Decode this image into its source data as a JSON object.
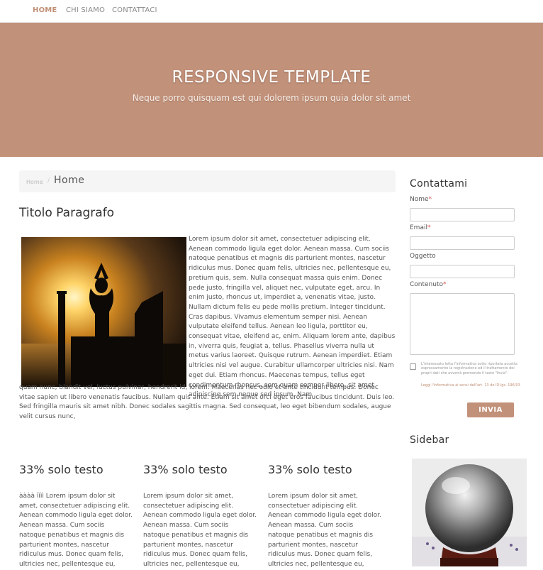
{
  "nav": {
    "items": [
      "HOME",
      "CHI SIAMO",
      "CONTATTACI"
    ]
  },
  "hero": {
    "title": "RESPONSIVE TEMPLATE",
    "subtitle": "Neque porro quisquam est qui dolorem ipsum quia dolor sit amet"
  },
  "breadcrumb": {
    "home": "Home",
    "separator": "/",
    "current": "Home"
  },
  "article": {
    "title": "Titolo Paragrafo",
    "text_right": "Lorem ipsum dolor sit amet, consectetuer adipiscing elit. Aenean commodo ligula eget dolor. Aenean massa. Cum sociis natoque penatibus et magnis dis parturient montes, nascetur ridiculus mus. Donec quam felis, ultricies nec, pellentesque eu, pretium quis, sem. Nulla consequat massa quis enim. Donec pede justo, fringilla vel, aliquet nec, vulputate eget, arcu. In enim justo, rhoncus ut, imperdiet a, venenatis vitae, justo. Nullam dictum felis eu pede mollis pretium. Integer tincidunt. Cras dapibus. Vivamus elementum semper nisi. Aenean vulputate eleifend tellus. Aenean leo ligula, porttitor eu, consequat vitae, eleifend ac, enim. Aliquam lorem ante, dapibus in, viverra quis, feugiat a, tellus. Phasellus viverra nulla ut metus varius laoreet. Quisque rutrum. Aenean imperdiet. Etiam ultricies nisi vel augue. Curabitur ullamcorper ultricies nisi. Nam eget dui. Etiam rhoncus. Maecenas tempus, tellus eget condimentum rhoncus, sem quam semper libero, sit amet adipiscing sem neque sed ipsum. Nam",
    "text_continued": "quam nunc, blandit vel, luctus pulvinar, hendrerit id, lorem. Maecenas nec odio et ante tincidunt tempus. Donec vitae sapien ut libero venenatis faucibus. Nullam quis ante. Etiam sit amet orci eget eros faucibus tincidunt. Duis leo. Sed fringilla mauris sit amet nibh. Donec sodales sagittis magna. Sed consequat, leo eget bibendum sodales, augue velit cursus nunc,"
  },
  "columns": [
    {
      "title": "33% solo testo",
      "text": "àààà ìììì Lorem ipsum dolor sit amet, consectetuer adipiscing elit. Aenean commodo ligula eget dolor. Aenean massa. Cum sociis natoque penatibus et magnis dis parturient montes, nascetur ridiculus mus. Donec quam felis, ultricies nec, pellentesque eu,"
    },
    {
      "title": "33% solo testo",
      "text": "Lorem ipsum dolor sit amet, consectetuer adipiscing elit. Aenean commodo ligula eget dolor. Aenean massa. Cum sociis natoque penatibus et magnis dis parturient montes, nascetur ridiculus mus. Donec quam felis, ultricies nec, pellentesque eu,"
    },
    {
      "title": "33% solo testo",
      "text": "Lorem ipsum dolor sit amet, consectetuer adipiscing elit. Aenean commodo ligula eget dolor. Aenean massa. Cum sociis natoque penatibus et magnis dis parturient montes, nascetur ridiculus mus. Donec quam felis, ultricies nec, pellentesque eu,"
    }
  ],
  "contact": {
    "title": "Contattami",
    "required_mark": "*",
    "fields": {
      "name": "Nome",
      "email": "Email",
      "subject": "Oggetto",
      "content": "Contenuto"
    },
    "privacy_text": "L'interessato letta l'informativa sotto riportata accetta espressamente la registrazione ed il trattamento dei propri dati che avverrà premendo il tasto \"Invia\".",
    "privacy_link": "Leggi l'informativa ai sensi dell'art. 13 del D.lgs. 196/03",
    "submit": "INVIA"
  },
  "sidebar": {
    "title": "Sidebar"
  },
  "colors": {
    "accent": "#c29179",
    "nav_active": "#c19076",
    "required": "#d9534f"
  },
  "icons": {
    "checkbox": "checkbox-icon"
  }
}
